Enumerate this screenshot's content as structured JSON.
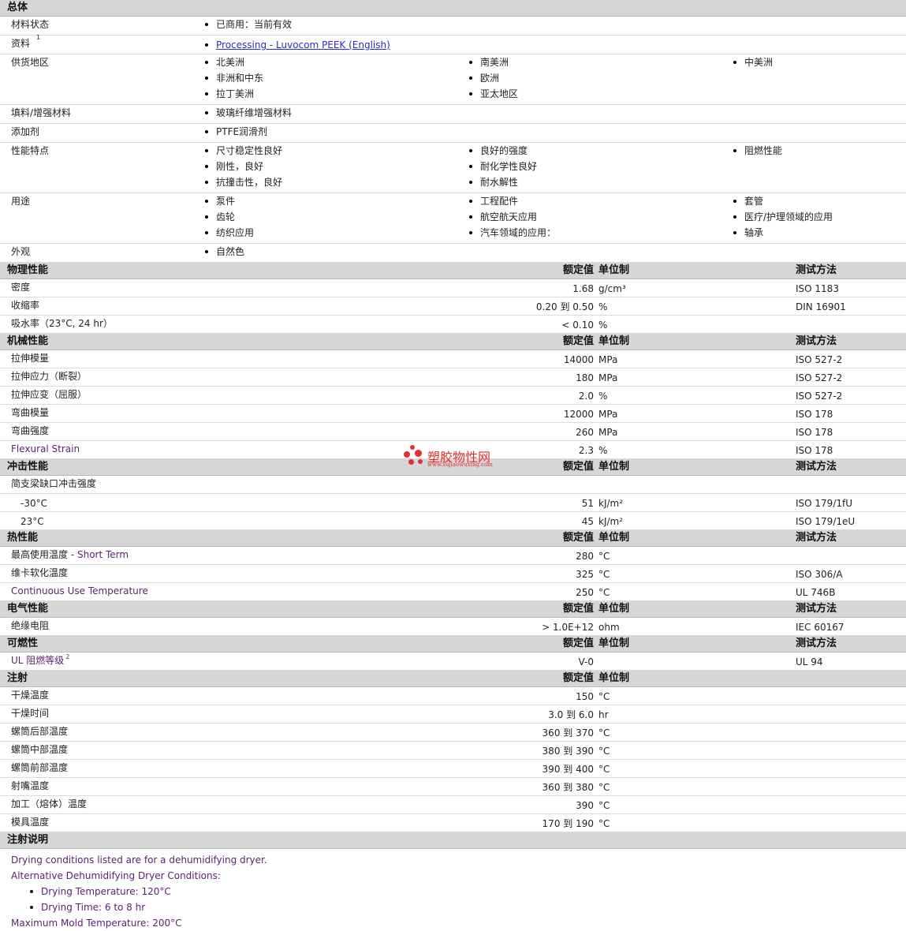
{
  "general": {
    "title": "总体",
    "rows": [
      {
        "label": "材料状态",
        "cols": [
          [
            "已商用：当前有效"
          ]
        ]
      },
      {
        "label": "资料",
        "sup": "1",
        "link": "Processing - Luvocom PEEK (English)"
      },
      {
        "label": "供货地区",
        "cols": [
          [
            "北美洲",
            "非洲和中东",
            "拉丁美洲"
          ],
          [
            "南美洲",
            "欧洲",
            "亚太地区"
          ],
          [
            "中美洲"
          ]
        ]
      },
      {
        "label": "填料/增强材料",
        "cols": [
          [
            "玻璃纤维增强材料"
          ]
        ]
      },
      {
        "label": "添加剂",
        "cols": [
          [
            "PTFE润滑剂"
          ]
        ]
      },
      {
        "label": "性能特点",
        "cols": [
          [
            "尺寸稳定性良好",
            "刚性，良好",
            "抗撞击性，良好"
          ],
          [
            "良好的强度",
            "耐化学性良好",
            "耐水解性"
          ],
          [
            "阻燃性能"
          ]
        ]
      },
      {
        "label": "用途",
        "cols": [
          [
            "泵件",
            "齿轮",
            "纺织应用"
          ],
          [
            "工程配件",
            "航空航天应用",
            "汽车领域的应用："
          ],
          [
            "套管",
            "医疗/护理领域的应用",
            "轴承"
          ]
        ]
      },
      {
        "label": "外观",
        "cols": [
          [
            "自然色"
          ]
        ]
      }
    ]
  },
  "headers": {
    "value": "额定值",
    "unit": "单位制",
    "method": "测试方法"
  },
  "sections": [
    {
      "title": "物理性能",
      "showMethod": true,
      "rows": [
        {
          "label": "密度",
          "value": "1.68",
          "unit": "g/cm³",
          "method": "ISO 1183"
        },
        {
          "label": "收缩率",
          "value": "0.20 到  0.50",
          "unit": "%",
          "method": "DIN 16901"
        },
        {
          "label": "吸水率（23°C, 24 hr）",
          "value": "< 0.10",
          "unit": "%",
          "method": ""
        }
      ]
    },
    {
      "title": "机械性能",
      "showMethod": true,
      "rows": [
        {
          "label": "拉伸模量",
          "value": "14000",
          "unit": "MPa",
          "method": "ISO 527-2"
        },
        {
          "label": "拉伸应力（断裂）",
          "value": "180",
          "unit": "MPa",
          "method": "ISO 527-2"
        },
        {
          "label": "拉伸应变（屈服）",
          "value": "2.0",
          "unit": "%",
          "method": "ISO 527-2"
        },
        {
          "label": "弯曲模量",
          "value": "12000",
          "unit": "MPa",
          "method": "ISO 178"
        },
        {
          "label": "弯曲强度",
          "value": "260",
          "unit": "MPa",
          "method": "ISO 178"
        },
        {
          "label": "Flexural Strain",
          "purple": true,
          "value": "2.3",
          "unit": "%",
          "method": "ISO 178"
        }
      ]
    },
    {
      "title": "冲击性能",
      "showMethod": true,
      "rows": [
        {
          "label": "简支梁缺口冲击强度",
          "value": "",
          "unit": "",
          "method": ""
        },
        {
          "sub": "-30°C",
          "value": "51",
          "unit": "kJ/m²",
          "method": "ISO 179/1fU"
        },
        {
          "sub": "23°C",
          "value": "45",
          "unit": "kJ/m²",
          "method": "ISO 179/1eU"
        }
      ]
    },
    {
      "title": "热性能",
      "showMethod": true,
      "rows": [
        {
          "label": "最高使用温度",
          "extra": " - Short Term",
          "value": "280",
          "unit": "°C",
          "method": ""
        },
        {
          "label": "维卡软化温度",
          "value": "325",
          "unit": "°C",
          "method": "ISO 306/A"
        },
        {
          "label": "Continuous Use Temperature",
          "purple": true,
          "value": "250",
          "unit": "°C",
          "method": "UL 746B"
        }
      ]
    },
    {
      "title": "电气性能",
      "showMethod": true,
      "rows": [
        {
          "label": "绝缘电阻",
          "value": "> 1.0E+12",
          "unit": "ohm",
          "method": "IEC 60167"
        }
      ]
    },
    {
      "title": "可燃性",
      "showMethod": true,
      "rows": [
        {
          "label": "UL 阻燃等级",
          "purple": true,
          "sup": "2",
          "value": "V-0",
          "unit": "",
          "method": "UL 94"
        }
      ]
    },
    {
      "title": "注射",
      "showMethod": false,
      "rows": [
        {
          "label": "干燥温度",
          "value": "150",
          "unit": "°C",
          "method": ""
        },
        {
          "label": "干燥时间",
          "value": "3.0 到  6.0",
          "unit": "hr",
          "method": ""
        },
        {
          "label": "螺筒后部温度",
          "value": "360 到  370",
          "unit": "°C",
          "method": ""
        },
        {
          "label": "螺筒中部温度",
          "value": "380 到  390",
          "unit": "°C",
          "method": ""
        },
        {
          "label": "螺筒前部温度",
          "value": "390 到  400",
          "unit": "°C",
          "method": ""
        },
        {
          "label": "射嘴温度",
          "value": "360 到  380",
          "unit": "°C",
          "method": ""
        },
        {
          "label": "加工（熔体）温度",
          "value": "390",
          "unit": "°C",
          "method": ""
        },
        {
          "label": "模具温度",
          "value": "170 到  190",
          "unit": "°C",
          "method": ""
        }
      ]
    }
  ],
  "notes": {
    "title": "注射说明",
    "lines": [
      {
        "text": "Drying conditions listed are for a dehumidifying dryer.",
        "bullet": false
      },
      {
        "text": "Alternative Dehumidifying Dryer Conditions:",
        "bullet": false
      },
      {
        "text": "Drying Temperature: 120°C",
        "bullet": true
      },
      {
        "text": "Drying Time: 6 to 8 hr",
        "bullet": true
      },
      {
        "text": "Maximum Mold Temperature: 200°C",
        "bullet": false
      }
    ]
  },
  "watermark": {
    "name": "塑胶物性网",
    "url": "www.sujiaowuxing.com",
    "color": "#e23030"
  }
}
